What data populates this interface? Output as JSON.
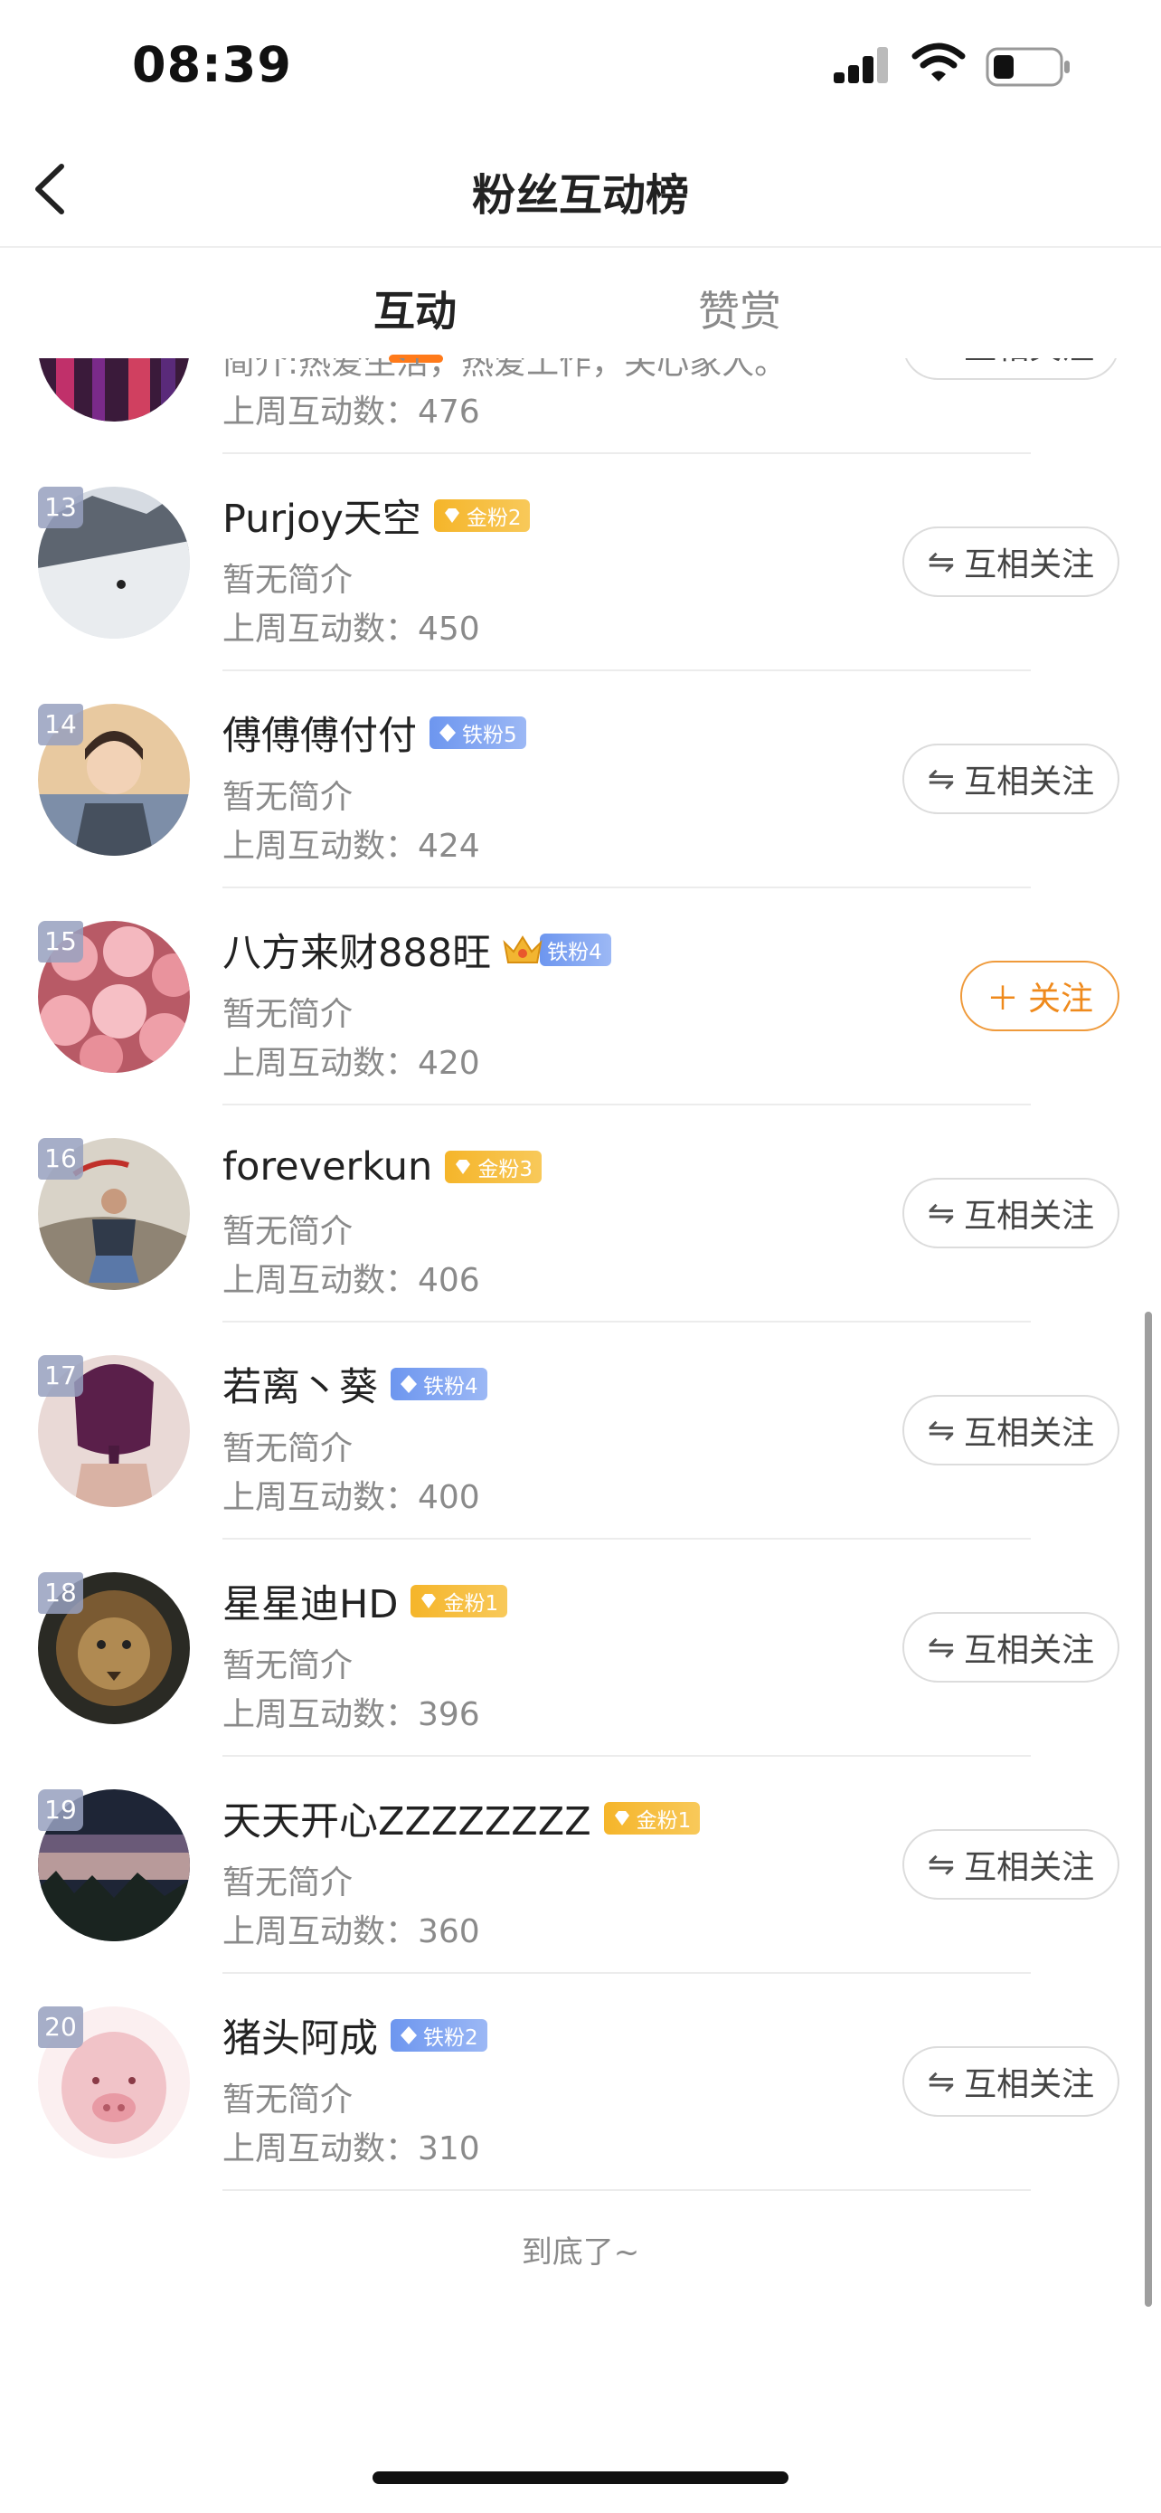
{
  "status": {
    "time": "08:39"
  },
  "nav": {
    "title": "粉丝互动榜"
  },
  "tabs": [
    {
      "label": "互动"
    },
    {
      "label": "赞赏"
    }
  ],
  "list": {
    "partial": {
      "desc": "简介:热爱生活，热爱工作，关心家人。",
      "count": "上周互动数：476",
      "button": "互相关注"
    },
    "items": [
      {
        "rank": "13",
        "name": "Purjoy天空",
        "badge": "金粉2",
        "badge_type": "gold",
        "desc": "暂无简介",
        "count": "上周互动数：450",
        "button": "互相关注",
        "button_icon": "⇋"
      },
      {
        "rank": "14",
        "name": "傅傅傅付付",
        "badge": "铁粉5",
        "badge_type": "iron",
        "desc": "暂无简介",
        "count": "上周互动数：424",
        "button": "互相关注",
        "button_icon": "⇋"
      },
      {
        "rank": "15",
        "name": "八方来财888旺",
        "badge": "铁粉4",
        "badge_type": "iron",
        "desc": "暂无简介",
        "count": "上周互动数：420",
        "button": "关注",
        "button_icon": "＋"
      },
      {
        "rank": "16",
        "name": "foreverkun",
        "badge": "金粉3",
        "badge_type": "gold",
        "desc": "暂无简介",
        "count": "上周互动数：406",
        "button": "互相关注",
        "button_icon": "⇋"
      },
      {
        "rank": "17",
        "name": "若离丶葵",
        "badge": "铁粉4",
        "badge_type": "iron",
        "desc": "暂无简介",
        "count": "上周互动数：400",
        "button": "互相关注",
        "button_icon": "⇋"
      },
      {
        "rank": "18",
        "name": "星星迪HD",
        "badge": "金粉1",
        "badge_type": "gold",
        "desc": "暂无简介",
        "count": "上周互动数：396",
        "button": "互相关注",
        "button_icon": "⇋"
      },
      {
        "rank": "19",
        "name": "天天开心ZZZZZZZZ",
        "badge": "金粉1",
        "badge_type": "gold",
        "desc": "暂无简介",
        "count": "上周互动数：360",
        "button": "互相关注",
        "button_icon": "⇋"
      },
      {
        "rank": "20",
        "name": "猪头阿成",
        "badge": "铁粉2",
        "badge_type": "iron",
        "desc": "暂无简介",
        "count": "上周互动数：310",
        "button": "互相关注",
        "button_icon": "⇋"
      }
    ],
    "end_text": "到底了~"
  },
  "colors": {
    "accent": "#ff7a1a",
    "gold_badge": "#f5b52a",
    "iron_badge": "#6d96ef"
  }
}
